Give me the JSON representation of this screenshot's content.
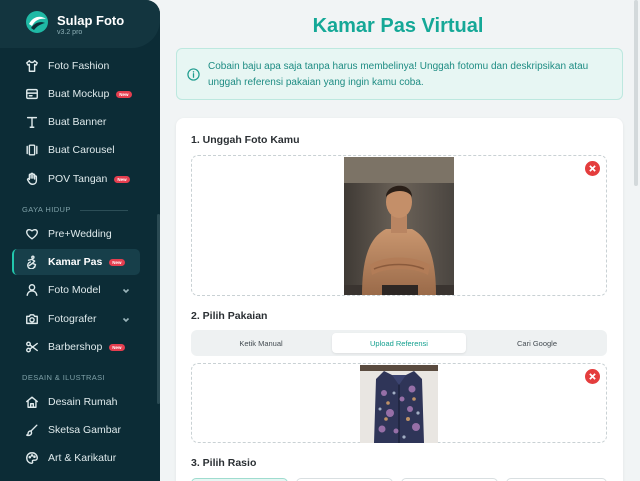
{
  "brand": {
    "name": "Sulap Foto",
    "version": "v3.2 pro"
  },
  "sidebar": {
    "items_top": [
      {
        "label": "Foto Fashion",
        "icon": "shirt-icon",
        "badge": ""
      },
      {
        "label": "Buat Mockup",
        "icon": "mockup-icon",
        "badge": "New"
      },
      {
        "label": "Buat Banner",
        "icon": "text-icon",
        "badge": ""
      },
      {
        "label": "Buat Carousel",
        "icon": "carousel-icon",
        "badge": ""
      },
      {
        "label": "POV Tangan",
        "icon": "hand-icon",
        "badge": "New"
      }
    ],
    "section_gaya": "GAYA HIDUP",
    "items_gaya": [
      {
        "label": "Pre+Wedding",
        "icon": "heart-icon",
        "badge": ""
      },
      {
        "label": "Kamar Pas",
        "icon": "accessibility-icon",
        "badge": "New",
        "active": true
      },
      {
        "label": "Foto Model",
        "icon": "user-icon",
        "badge": ""
      },
      {
        "label": "Fotografer",
        "icon": "camera-icon",
        "badge": ""
      },
      {
        "label": "Barbershop",
        "icon": "scissors-icon",
        "badge": "New"
      }
    ],
    "section_desain": "DESAIN & ILUSTRASI",
    "items_desain": [
      {
        "label": "Desain Rumah",
        "icon": "home-icon",
        "badge": ""
      },
      {
        "label": "Sketsa Gambar",
        "icon": "brush-icon",
        "badge": ""
      },
      {
        "label": "Art & Karikatur",
        "icon": "palette-icon",
        "badge": ""
      }
    ]
  },
  "main": {
    "title": "Kamar Pas Virtual",
    "info": "Cobain baju apa saja tanpa harus membelinya! Unggah fotomu dan deskripsikan atau unggah referensi pakaian yang ingin kamu coba.",
    "step1": "1. Unggah Foto Kamu",
    "step2": "2. Pilih Pakaian",
    "step3": "3. Pilih Rasio",
    "tabs": [
      "Ketik Manual",
      "Upload Referensi",
      "Cari Google"
    ],
    "active_tab": 1
  },
  "colors": {
    "accent": "#15a897",
    "sidebar_bg": "#0c2c36",
    "badge": "#e53e4f",
    "remove": "#e43d3d"
  }
}
